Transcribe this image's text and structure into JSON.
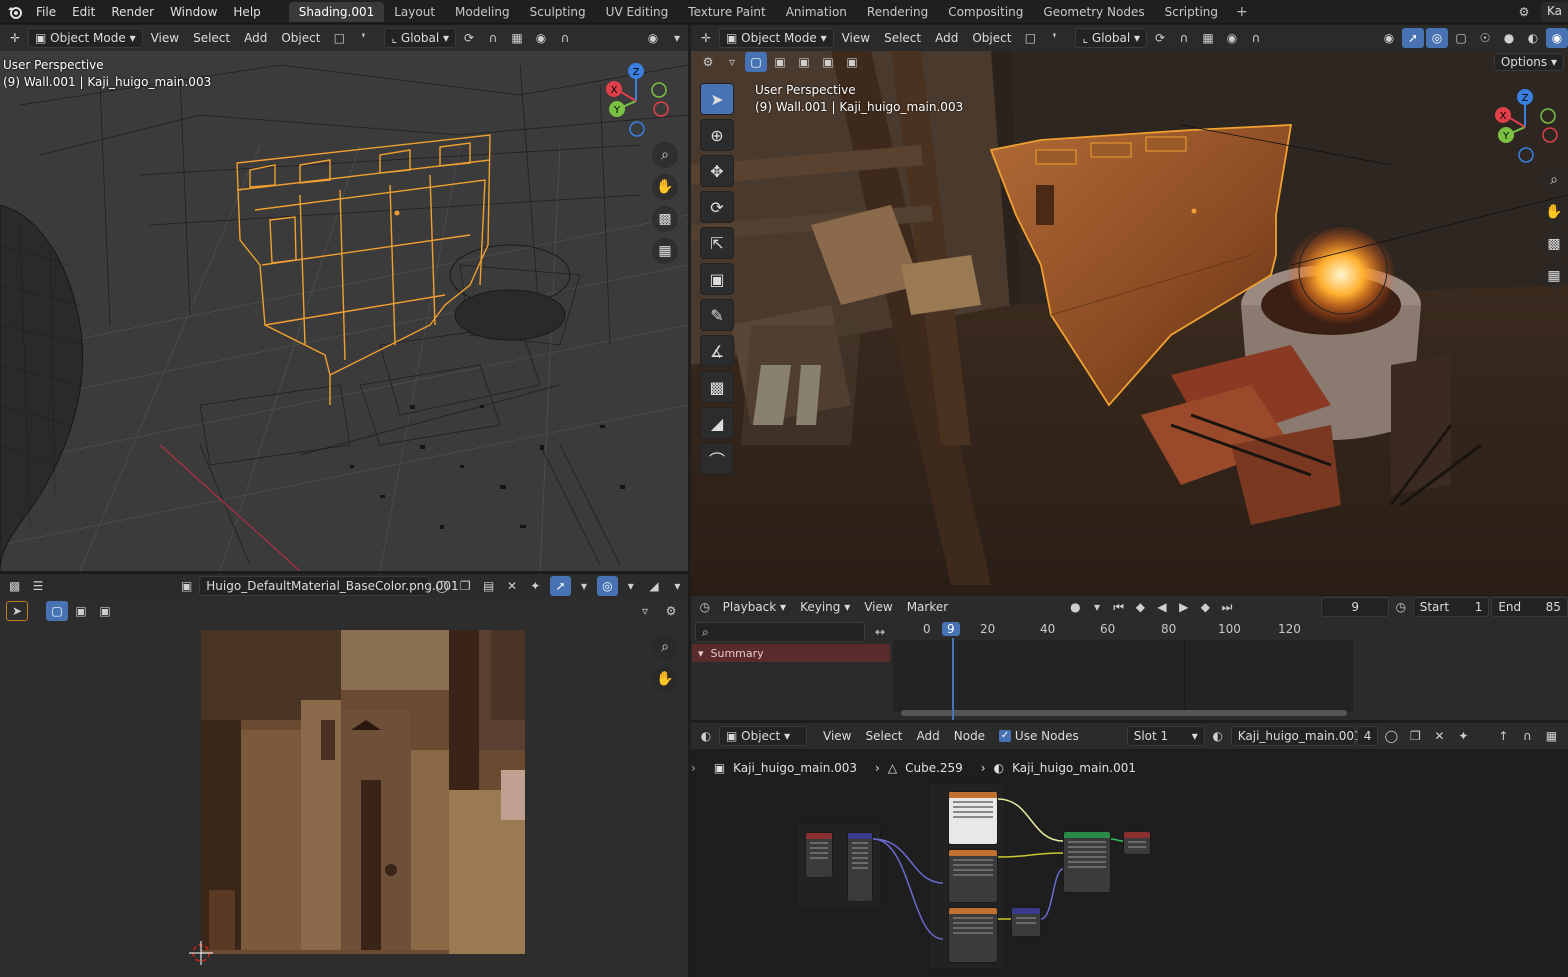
{
  "menu": [
    "File",
    "Edit",
    "Render",
    "Window",
    "Help"
  ],
  "workspace_tabs": [
    "Shading.001",
    "Layout",
    "Modeling",
    "Sculpting",
    "UV Editing",
    "Texture Paint",
    "Animation",
    "Rendering",
    "Compositing",
    "Geometry Nodes",
    "Scripting"
  ],
  "active_tab": "Shading.001",
  "tab_add": "+",
  "scene_label": "Ka",
  "viewport_left": {
    "mode": "Object Mode",
    "menus": [
      "View",
      "Select",
      "Add",
      "Object"
    ],
    "orientation": "Global",
    "perspective": "User Perspective",
    "context": "(9) Wall.001 | Kaji_huigo_main.003",
    "gizmo": {
      "z": "Z",
      "y": "Y",
      "x": "X"
    }
  },
  "viewport_right": {
    "mode": "Object Mode",
    "menus": [
      "View",
      "Select",
      "Add",
      "Object"
    ],
    "orientation": "Global",
    "perspective": "User Perspective",
    "context": "(9) Wall.001 | Kaji_huigo_main.003",
    "options": "Options",
    "gizmo": {
      "z": "Z",
      "y": "Y",
      "x": "X"
    }
  },
  "image_editor": {
    "image_name": "Huigo_DefaultMaterial_BaseColor.png.001"
  },
  "timeline": {
    "menus": [
      "Playback",
      "Keying",
      "View",
      "Marker"
    ],
    "current_frame": "9",
    "start_label": "Start",
    "start": "1",
    "end_label": "End",
    "end": "85",
    "ticks": [
      "0",
      "20",
      "40",
      "60",
      "80",
      "100",
      "120"
    ],
    "playhead": "9",
    "summary": "Summary"
  },
  "node_editor": {
    "type": "Object",
    "menus": [
      "View",
      "Select",
      "Add",
      "Node"
    ],
    "use_nodes": "Use Nodes",
    "slot": "Slot 1",
    "material": "Kaji_huigo_main.001",
    "users": "4",
    "breadcrumbs": [
      "Kaji_huigo_main.003",
      "Cube.259",
      "Kaji_huigo_main.001"
    ]
  },
  "colors": {
    "accent": "#4772b3",
    "selection": "#f0a030",
    "axis_x": "#e0404a",
    "axis_y": "#7ac043",
    "axis_z": "#3a80e0"
  }
}
